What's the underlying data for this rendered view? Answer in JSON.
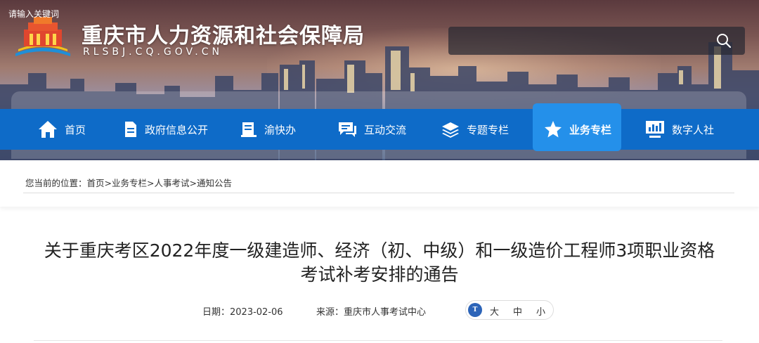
{
  "header": {
    "site_title": "重庆市人力资源和社会保障局",
    "site_domain": "RLSBJ.CQ.GOV.CN",
    "search": {
      "placeholder": "请输入关键词"
    }
  },
  "nav": {
    "items": [
      {
        "label": "首页",
        "icon": "home-icon"
      },
      {
        "label": "政府信息公开",
        "icon": "document-icon"
      },
      {
        "label": "渝快办",
        "icon": "book-icon"
      },
      {
        "label": "互动交流",
        "icon": "chat-icon"
      },
      {
        "label": "专题专栏",
        "icon": "layers-icon"
      },
      {
        "label": "业务专栏",
        "icon": "star-icon",
        "active": true
      },
      {
        "label": "数字人社",
        "icon": "monitor-chart-icon"
      }
    ],
    "active_color": "#2490ea",
    "bar_color": "#0e6bc8"
  },
  "breadcrumb": {
    "prefix": "您当前的位置：",
    "items": [
      "首页",
      "业务专栏",
      "人事考试",
      "通知公告"
    ],
    "separator": ">"
  },
  "article": {
    "title_line1": "关于重庆考区2022年度一级建造师、经济（初、中级）和一级造价工程师3项职业资格",
    "title_line2": "考试补考安排的通告",
    "date_label": "日期：",
    "date": "2023-02-06",
    "source_label": "来源：",
    "source": "重庆市人事考试中心",
    "font_size_icon_text": "T",
    "font_sizes": [
      "大",
      "中",
      "小"
    ]
  }
}
